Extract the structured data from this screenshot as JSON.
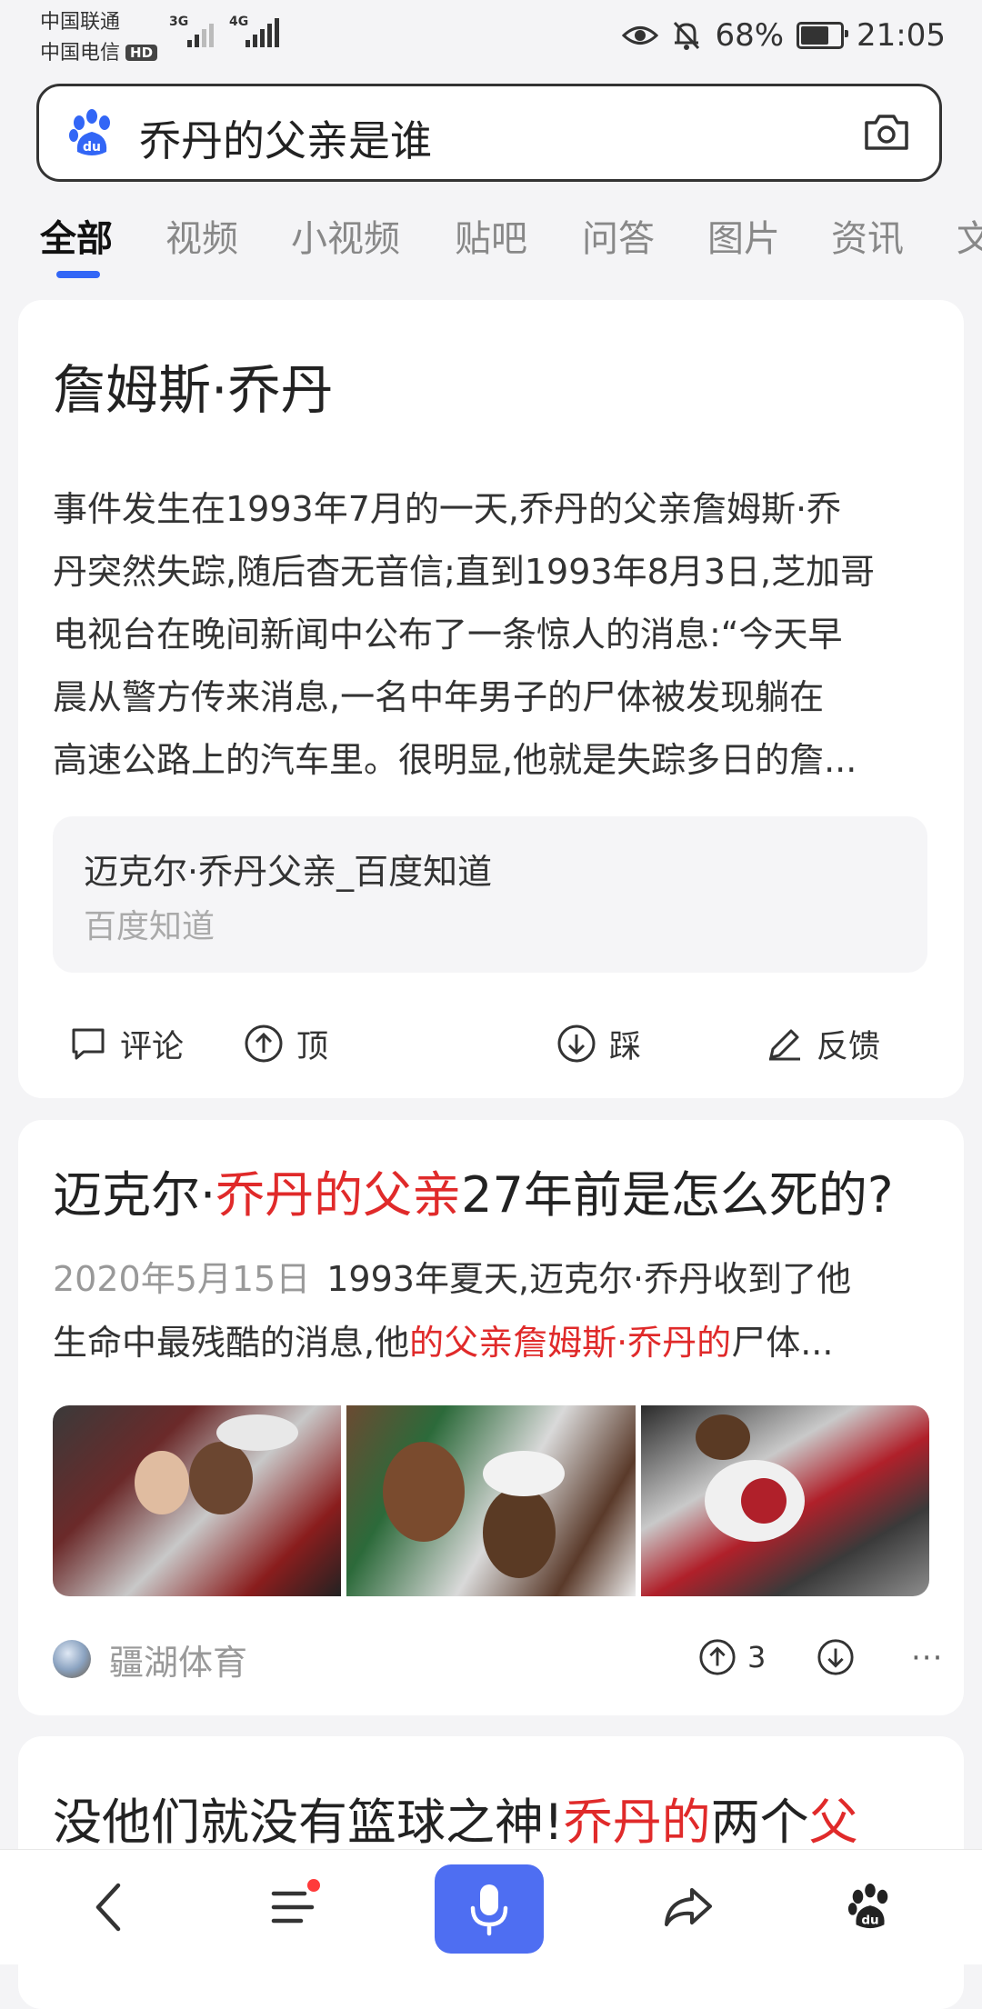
{
  "status_bar": {
    "carrier1": "中国联通",
    "carrier2": "中国电信",
    "hd_badge": "HD",
    "net1": "3G",
    "net2": "4G",
    "battery": "68%",
    "time": "21:05"
  },
  "search": {
    "query": "乔丹的父亲是谁"
  },
  "tabs": [
    "全部",
    "视频",
    "小视频",
    "贴吧",
    "问答",
    "图片",
    "资讯",
    "文"
  ],
  "knowledge_card": {
    "title": "詹姆斯·乔丹",
    "lines": [
      "事件发生在1993年7月的一天,乔丹的父亲詹姆斯·乔",
      "丹突然失踪,随后杳无音信;直到1993年8月3日,芝加哥",
      "电视台在晚间新闻中公布了一条惊人的消息:“今天早",
      "晨从警方传来消息,一名中年男子的尸体被发现躺在",
      "高速公路上的汽车里。很明显,他就是失踪多日的詹..."
    ],
    "source_title": "迈克尔·乔丹父亲_百度知道",
    "source_name": "百度知道",
    "actions": {
      "comment": "评论",
      "upvote": "顶",
      "downvote": "踩",
      "feedback": "反馈"
    }
  },
  "result2": {
    "title_pre": "迈克尔·",
    "title_hl": "乔丹的父亲",
    "title_post": "27年前是怎么死的?",
    "date": "2020年5月15日",
    "line1": "1993年夏天,迈克尔·乔丹收到了他",
    "line2_pre": "生命中最残酷的消息,他",
    "line2_hl": "的父亲詹姆斯·乔丹的",
    "line2_post": "尸体...",
    "author": "疆湖体育",
    "up_count": "3",
    "more": "···"
  },
  "result3": {
    "title_pre": "没他们就没有篮球之神!",
    "title_hl1": "乔丹的",
    "title_mid": "两个",
    "title_hl2": "父"
  },
  "colors": {
    "accent_blue": "#3266f6",
    "highlight_red": "#e02a2a",
    "mic_blue": "#4e6ef2"
  },
  "icons": [
    "back-icon",
    "menu-icon",
    "mic-icon",
    "share-icon",
    "baidu-paw-icon",
    "camera-icon",
    "comment-icon",
    "upvote-icon",
    "downvote-icon",
    "feedback-pen-icon"
  ]
}
